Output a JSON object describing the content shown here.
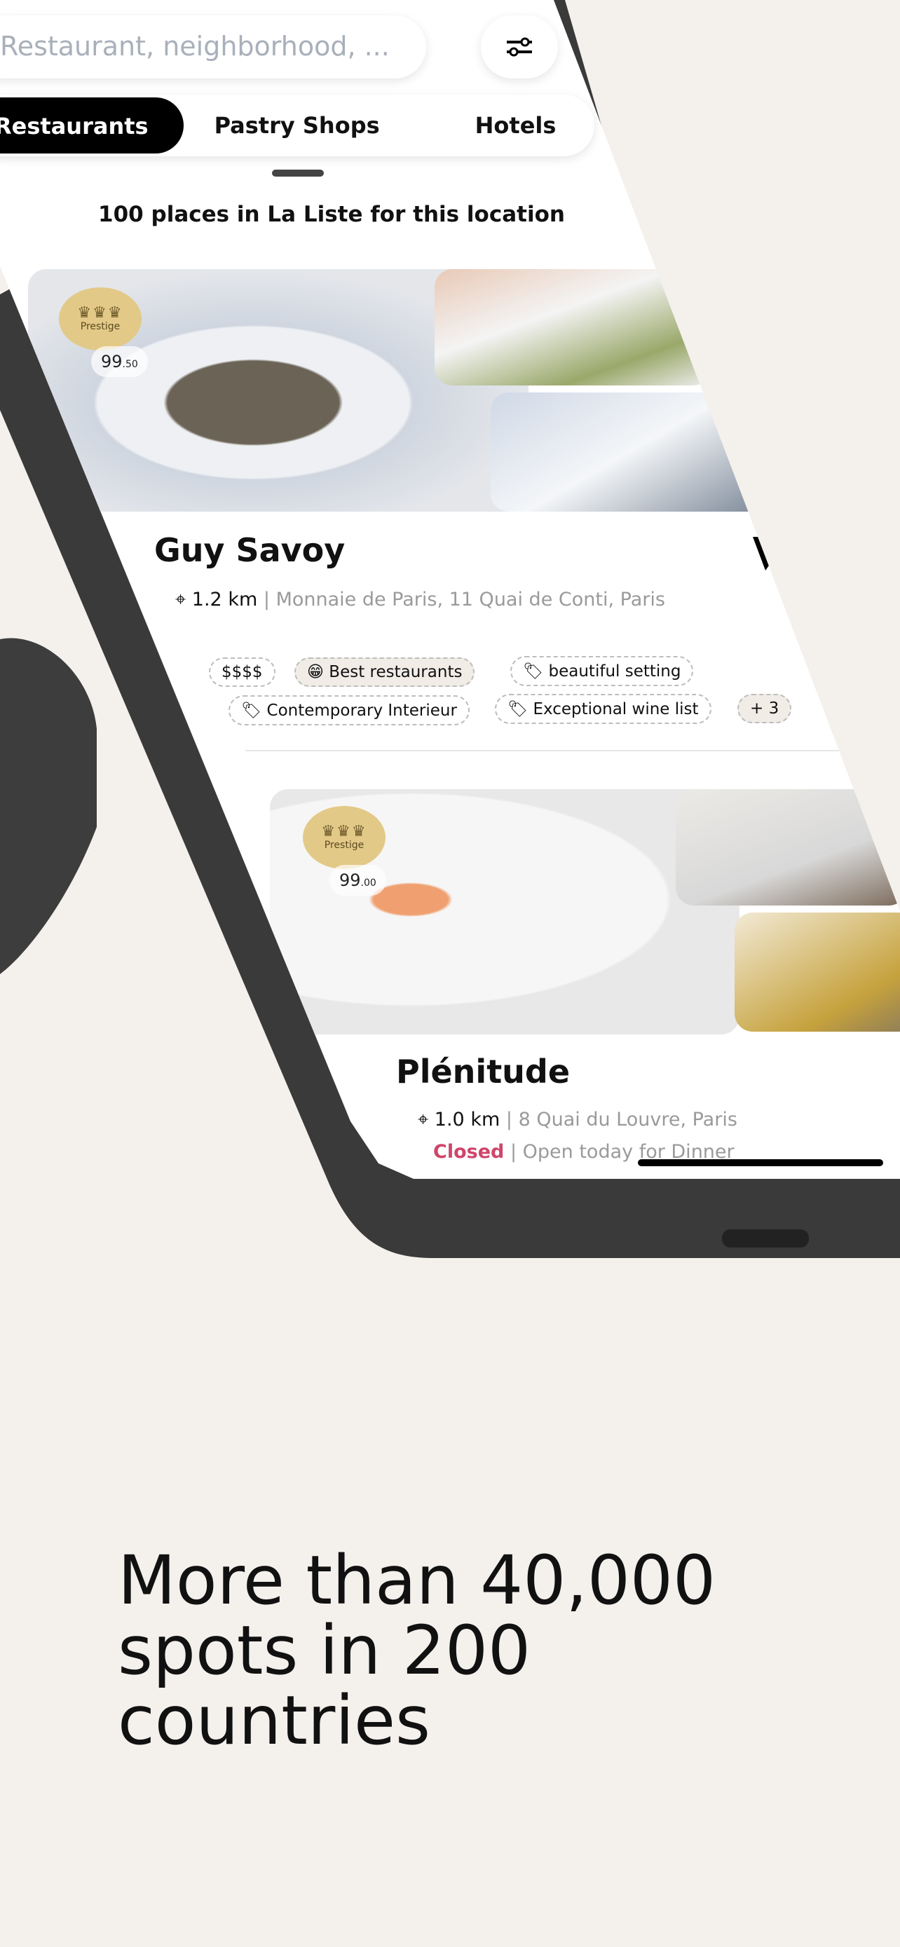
{
  "search": {
    "placeholder": "Restaurant, neighborhood, ..."
  },
  "icons": {
    "filter": "sliders-icon",
    "location": "map-pin-icon",
    "bookmark": "bookmark-icon",
    "tag": "tag-icon"
  },
  "tabs": [
    {
      "label": "Restaurants",
      "active": true
    },
    {
      "label": "Pastry Shops"
    },
    {
      "label": "Hotels"
    }
  ],
  "results": {
    "count_text": "100 places in La Liste for this location"
  },
  "cards": [
    {
      "name": "Guy Savoy",
      "badge": "Prestige",
      "score_int": "99",
      "score_dec": ".50",
      "distance": "1.2 km",
      "address": "Monnaie de Paris, 11 Quai de Conti, Paris",
      "bookmarked": true,
      "tags": [
        "$$$$",
        "Best restaurants",
        "beautiful setting",
        "Contemporary Interieur",
        "Exceptional wine list",
        "+ 3"
      ]
    },
    {
      "name": "Plénitude",
      "badge": "Prestige",
      "score_int": "99",
      "score_dec": ".00",
      "distance": "1.0 km",
      "address": "8 Quai du Louvre, Paris",
      "status": "Closed",
      "hours": "Open today for Dinner"
    }
  ],
  "colors": {
    "background": "#f4f0ec",
    "badge": "#e3c987",
    "closed": "#d0456a",
    "frame": "#3a3a3a"
  },
  "headline": "More than 40,000 spots in 200 countries"
}
